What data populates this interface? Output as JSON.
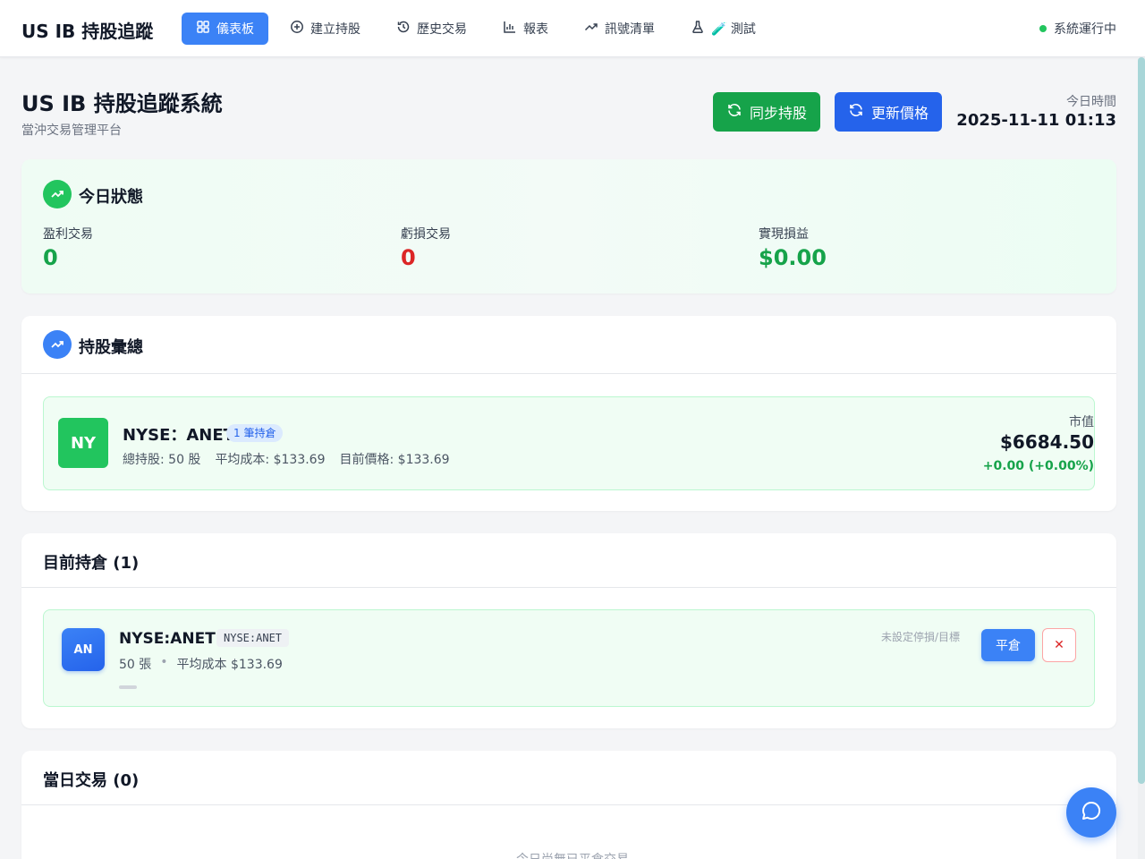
{
  "app": {
    "brand": "US IB 持股追蹤",
    "status_text": "系統運行中"
  },
  "nav": {
    "items": [
      {
        "label": "儀表板",
        "icon": "dashboard-icon",
        "active": true
      },
      {
        "label": "建立持股",
        "icon": "plus-circle-icon",
        "active": false
      },
      {
        "label": "歷史交易",
        "icon": "history-icon",
        "active": false
      },
      {
        "label": "報表",
        "icon": "bar-chart-icon",
        "active": false
      },
      {
        "label": "訊號清單",
        "icon": "trending-up-icon",
        "active": false
      },
      {
        "label": "🧪 測試",
        "icon": "flask-icon",
        "active": false
      }
    ]
  },
  "header": {
    "title": "US IB 持股追蹤系統",
    "subtitle": "當沖交易管理平台",
    "sync_button": "同步持股",
    "update_button": "更新價格",
    "today_label": "今日時間",
    "today_value": "2025-11-11 01:13"
  },
  "today_status": {
    "title": "今日狀態",
    "stats": [
      {
        "label": "盈利交易",
        "value": "0",
        "color": "#16a34a"
      },
      {
        "label": "虧損交易",
        "value": "0",
        "color": "#dc2626"
      },
      {
        "label": "實現損益",
        "value": "$0.00",
        "color": "#16a34a"
      }
    ]
  },
  "holdings_summary": {
    "title": "持股彙總",
    "items": [
      {
        "badge": "NY",
        "symbol": "NYSE：ANET",
        "count_badge": "1 筆持倉",
        "total_shares": "總持股: 50 股",
        "avg_cost": "平均成本: $133.69",
        "current_price": "目前價格: $133.69",
        "market_value_label": "市值",
        "market_value": "$6684.50",
        "change": "+0.00 (+0.00%)"
      }
    ]
  },
  "current_positions": {
    "title": "目前持倉 (1)",
    "items": [
      {
        "badge": "AN",
        "symbol": "NYSE:ANET",
        "tag": "NYSE:ANET",
        "quantity": "50 張",
        "separator": "•",
        "avg_cost": "平均成本 $133.69",
        "hint": "未設定停損/目標",
        "close_button": "平倉",
        "remove_button": "✕"
      }
    ]
  },
  "today_trades": {
    "title": "當日交易 (0)",
    "empty_text": "今日尚無已平倉交易"
  },
  "colors": {
    "primary": "#3b82f6",
    "success": "#16a34a",
    "danger": "#dc2626"
  }
}
